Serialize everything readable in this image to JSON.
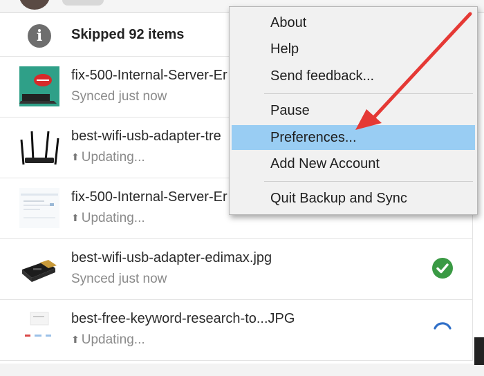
{
  "skipped": {
    "text": "Skipped 92 items",
    "icon": "info-icon"
  },
  "files": [
    {
      "name": "fix-500-Internal-Server-Er",
      "status": "Synced just now",
      "state": "synced",
      "thumb": "laptop-error-thumbnail"
    },
    {
      "name": "best-wifi-usb-adapter-tre",
      "status": "Updating...",
      "state": "updating",
      "thumb": "wifi-router-thumbnail"
    },
    {
      "name": "fix-500-Internal-Server-Er",
      "status": "Updating...",
      "state": "updating",
      "thumb": "webpage-screenshot-thumbnail"
    },
    {
      "name": "best-wifi-usb-adapter-edimax.jpg",
      "status": "Synced just now",
      "state": "synced",
      "status_icon": "check-circle-icon",
      "thumb": "usb-adapter-thumbnail"
    },
    {
      "name": "best-free-keyword-research-to...JPG",
      "status": "Updating...",
      "state": "updating",
      "status_icon": "sync-spinner-icon",
      "thumb": "keyword-tool-thumbnail"
    }
  ],
  "menu": {
    "items": [
      {
        "label": "About"
      },
      {
        "label": "Help"
      },
      {
        "label": "Send feedback..."
      },
      {
        "label": "Pause"
      },
      {
        "label": "Preferences...",
        "highlighted": true
      },
      {
        "label": "Add New Account"
      },
      {
        "label": "Quit Backup and Sync"
      }
    ]
  },
  "colors": {
    "menu_highlight": "#99cdf3",
    "menu_bg": "#f1f1f1",
    "synced_green": "#3a9a44",
    "spinner_blue": "#2f6fc8",
    "annotation_arrow": "#e53935"
  }
}
